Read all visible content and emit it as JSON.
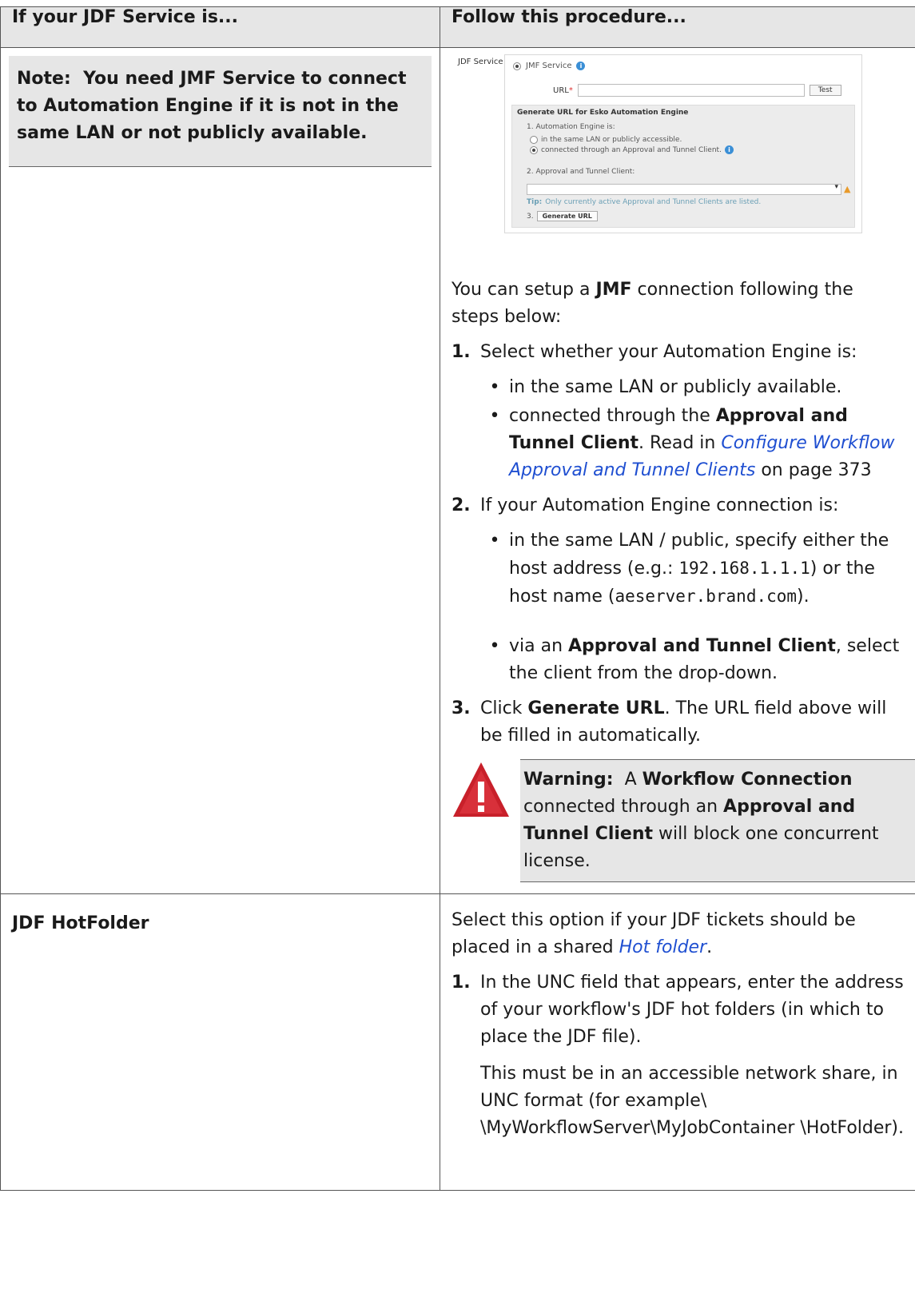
{
  "table": {
    "header_left": "If your JDF Service is...",
    "header_right": "Follow this procedure..."
  },
  "row1": {
    "note_label": "Note:",
    "note_text": "You need JMF Service to connect to Automation Engine if it is not in the same LAN or not publicly available.",
    "screenshot": {
      "service_label": "JDF Service",
      "jmf_option": "JMF Service",
      "url_label": "URL",
      "url_required": "*",
      "test_button": "Test",
      "generate_title": "Generate URL for Esko Automation Engine",
      "step1": "1. Automation Engine is:",
      "option_lan": "in the same LAN or publicly accessible.",
      "option_tunnel": "connected through an Approval and Tunnel Client.",
      "step2": "2. Approval and Tunnel Client:",
      "tip_label": "Tip:",
      "tip_text": "Only currently active Approval and Tunnel Clients are listed.",
      "step3": "3.",
      "generate_button": "Generate URL"
    },
    "intro_pre": "You can setup a ",
    "intro_bold": "JMF",
    "intro_post": " connection following the steps below:",
    "step1_num": "1.",
    "step1_text": "Select whether your Automation Engine is:",
    "step1_b1": "in the same LAN or publicly available.",
    "step1_b2_pre": "connected through the ",
    "step1_b2_bold": "Approval and Tunnel Client",
    "step1_b2_mid": ". Read in ",
    "step1_b2_link": "Configure Workflow Approval and Tunnel Clients",
    "step1_b2_post": " on page 373",
    "step2_num": "2.",
    "step2_text": "If your Automation Engine connection is:",
    "step2_b1_pre": "in the same LAN / public, specify either the host address (e.g.: ",
    "step2_b1_ip": "192.168.1.1.1",
    "step2_b1_mid": ") or the host name (",
    "step2_b1_host": "aeserver.brand.com",
    "step2_b1_post": ").",
    "step2_b2_pre": "via an ",
    "step2_b2_bold": "Approval and Tunnel Client",
    "step2_b2_post": ", select the client from the drop-down.",
    "step3_num": "3.",
    "step3_pre": "Click ",
    "step3_bold": "Generate URL",
    "step3_post": ". The URL field above will be filled in automatically.",
    "warning_label": "Warning:",
    "warning_a": "A ",
    "warning_b1": "Workflow Connection",
    "warning_c": " connected through an ",
    "warning_b2": "Approval and Tunnel Client",
    "warning_d": " will block one concurrent license."
  },
  "row2": {
    "label": "JDF HotFolder",
    "intro_pre": "Select this option if your JDF tickets should be placed in a shared ",
    "intro_link": "Hot folder",
    "intro_post": ".",
    "step1_num": "1.",
    "step1_text": "In the UNC field that appears, enter the address of your workflow's JDF hot folders (in which to place the JDF file).",
    "step1_extra": "This must be in an accessible network share, in UNC format (for example\\ \\MyWorkflowServer\\MyJobContainer \\HotFolder)."
  },
  "colors": {
    "link": "#1f4fd1",
    "note_bg": "#e6e6e6",
    "warning_red": "#c8202a"
  }
}
